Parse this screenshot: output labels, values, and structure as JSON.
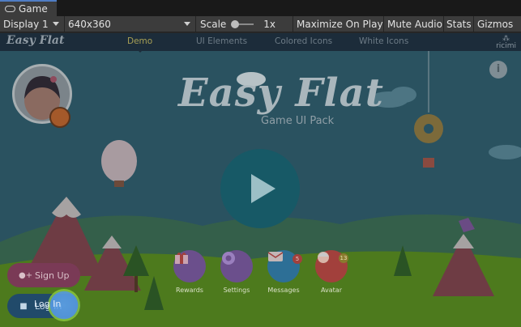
{
  "editor": {
    "tab_title": "Game",
    "display": "Display 1",
    "resolution": "640x360",
    "scale_label": "Scale",
    "scale_value": "1x",
    "maximize_on_play": "Maximize On Play",
    "mute_audio": "Mute Audio",
    "stats": "Stats",
    "gizmos": "Gizmos"
  },
  "game": {
    "logo_small": "Easy Flat",
    "nav": [
      "Demo",
      "UI Elements",
      "Colored Icons",
      "White Icons"
    ],
    "active_nav": "Demo",
    "brand": "ricimi",
    "title": "Easy Flat",
    "subtitle": "Game UI Pack",
    "info_glyph": "i",
    "actions": [
      {
        "label": "Rewards",
        "icon": "gift-icon",
        "color": "#6b4f8c"
      },
      {
        "label": "Settings",
        "icon": "gear-icon",
        "color": "#6b4f8c"
      },
      {
        "label": "Messages",
        "icon": "mail-icon",
        "color": "#2d6f96",
        "badge": "5"
      },
      {
        "label": "Avatar",
        "icon": "avatar-icon",
        "color": "#a2403c",
        "badge": "13"
      }
    ],
    "signup": "Sign Up",
    "login": "Log In"
  },
  "colors": {
    "sky": "#2a5260",
    "grass": "#4d7a1d",
    "play": "#175966",
    "signup": "#7a3a56",
    "login": "#214a6a"
  }
}
